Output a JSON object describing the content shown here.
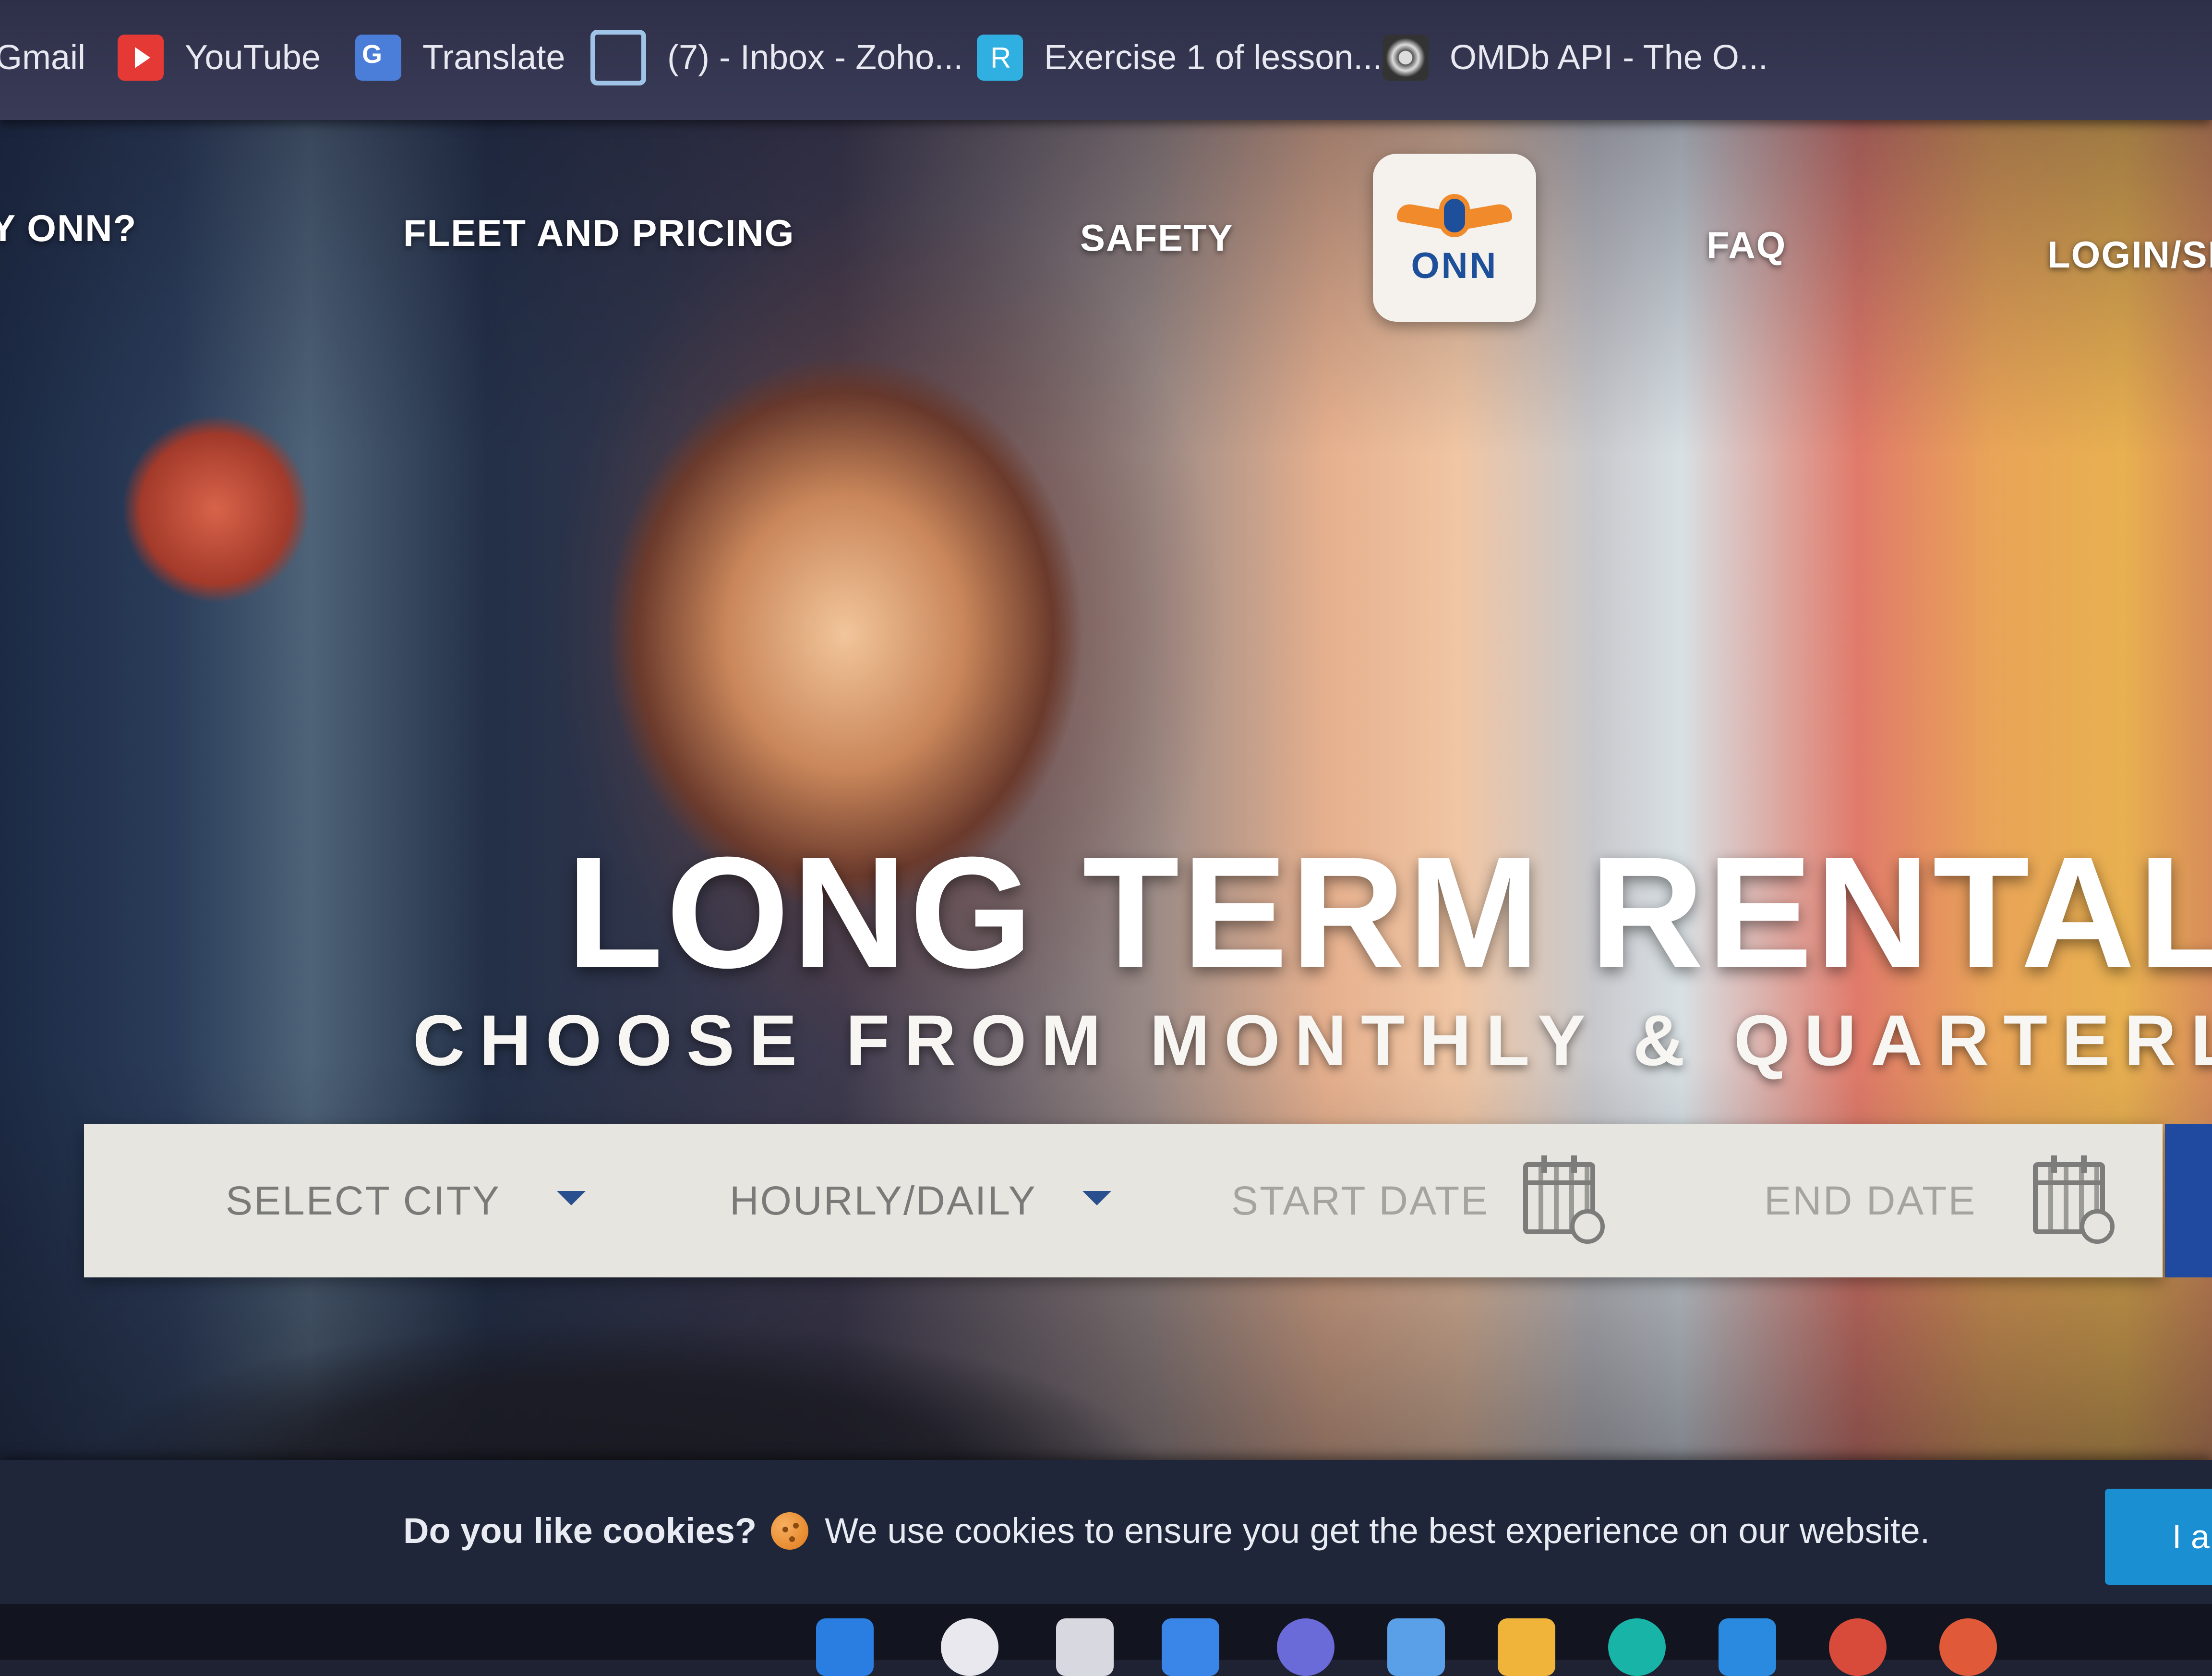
{
  "bookmarks": [
    {
      "label": "Gmail",
      "icon": "gmail-icon"
    },
    {
      "label": "YouTube",
      "icon": "youtube-icon"
    },
    {
      "label": "Translate",
      "icon": "translate-icon"
    },
    {
      "label": "(7) - Inbox - Zoho...",
      "icon": "zoho-icon"
    },
    {
      "label": "Exercise 1 of lesson...",
      "icon": "exercise-icon"
    },
    {
      "label": "OMDb API - The O...",
      "icon": "omdb-icon"
    }
  ],
  "nav": {
    "why": "Y ONN?",
    "fleet": "FLEET AND PRICING",
    "safety": "SAFETY",
    "logo_text": "ONN",
    "faq": "FAQ",
    "login": "LOGIN/SI"
  },
  "hero": {
    "headline": "LONG TERM RENTALS",
    "subheadline": "CHOOSE FROM MONTHLY & QUARTERLY PLA"
  },
  "search": {
    "city": "SELECT CITY",
    "mode": "HOURLY/DAILY",
    "start_date": "START DATE",
    "end_date": "END DATE"
  },
  "cookie": {
    "title": "Do you like cookies?",
    "message": "We use cookies to ensure you get the best experience on our website.",
    "button": "I a"
  },
  "colors": {
    "brand_blue": "#1e4f9a",
    "brand_orange": "#f08a2a",
    "cookie_button": "#1a8fd1"
  }
}
